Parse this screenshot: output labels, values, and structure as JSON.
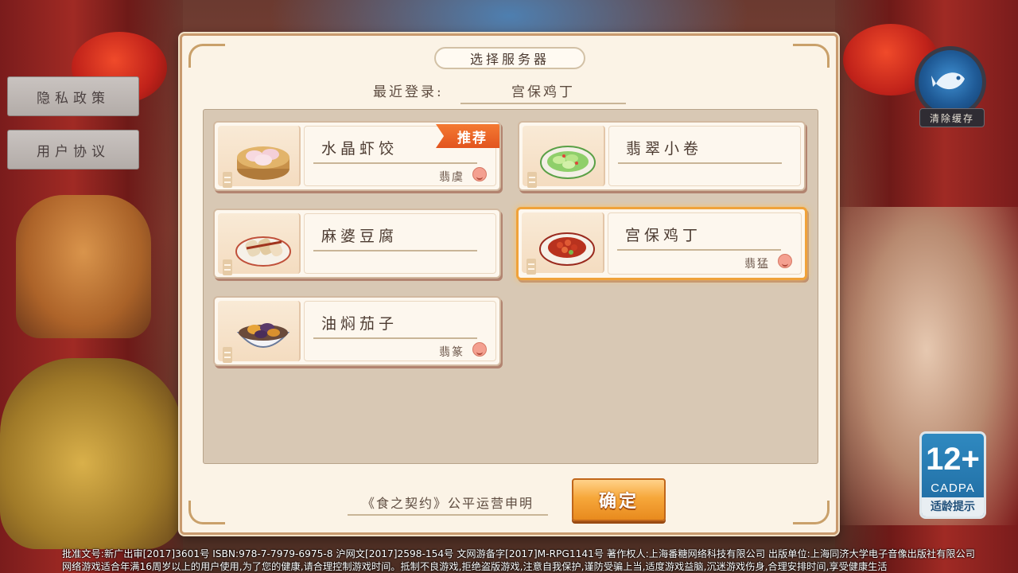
{
  "side_menu": {
    "privacy": "隐私政策",
    "agreement": "用户协议"
  },
  "clear_cache": {
    "label": "清除缓存",
    "icon": "fish-icon"
  },
  "dialog": {
    "title": "选择服务器",
    "recent_label": "最近登录:",
    "recent_value": "宫保鸡丁",
    "servers": [
      {
        "name": "水晶虾饺",
        "owner": "翡虞",
        "badge": "推荐",
        "icon": "dumpling-steamer-icon"
      },
      {
        "name": "翡翠小卷",
        "owner": "",
        "badge": "",
        "icon": "green-rolls-icon"
      },
      {
        "name": "麻婆豆腐",
        "owner": "",
        "badge": "",
        "icon": "tofu-rolls-icon"
      },
      {
        "name": "宫保鸡丁",
        "owner": "翡猛",
        "badge": "",
        "icon": "kungpao-chicken-icon",
        "selected": true
      },
      {
        "name": "油焖茄子",
        "owner": "翡篆",
        "badge": "",
        "icon": "braised-eggplant-icon"
      }
    ],
    "footer_text": "《食之契约》公平运营申明",
    "confirm_label": "确定"
  },
  "age_rating": {
    "number": "12+",
    "org": "CADPA",
    "tip": "适龄提示"
  },
  "legal": {
    "line1": "批准文号:新广出审[2017]3601号 ISBN:978-7-7979-6975-8 沪网文[2017]2598-154号 文网游备字[2017]M-RPG1141号 著作权人:上海番糖网络科技有限公司 出版单位:上海同济大学电子音像出版社有限公司",
    "line2": "网络游戏适合年满16周岁以上的用户使用,为了您的健康,请合理控制游戏时间。抵制不良游戏,拒绝盗版游戏,注意自我保护,谨防受骗上当,适度游戏益脑,沉迷游戏伤身,合理安排时间,享受健康生活"
  },
  "colors": {
    "accent": "#f6a73a",
    "badge": "#e2541e",
    "panel_bg": "#fbf3e6"
  }
}
